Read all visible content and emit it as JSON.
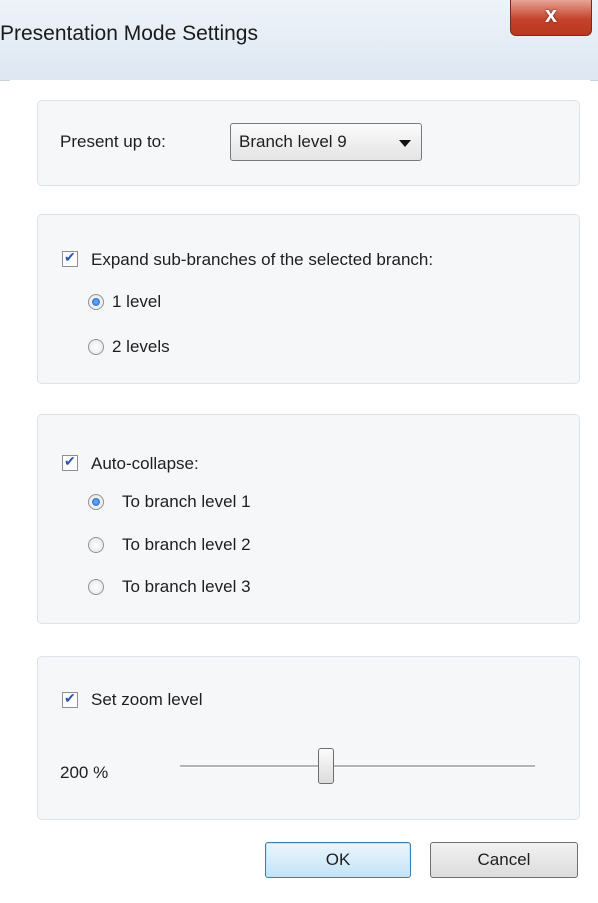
{
  "window": {
    "title": "Presentation Mode Settings",
    "close_label": "x"
  },
  "present": {
    "label": "Present up to:",
    "selected": "Branch level 9"
  },
  "expand": {
    "label": "Expand sub-branches of the selected branch:",
    "checked": true,
    "options": [
      "1 level",
      "2 levels"
    ],
    "selected_index": 0
  },
  "collapse": {
    "label": "Auto-collapse:",
    "checked": true,
    "options": [
      "To branch level 1",
      "To branch level 2",
      "To branch level 3"
    ],
    "selected_index": 0
  },
  "zoom": {
    "label": "Set zoom level",
    "checked": true,
    "value_text": "200 %",
    "slider_fraction": 0.41
  },
  "buttons": {
    "ok": "OK",
    "cancel": "Cancel"
  }
}
